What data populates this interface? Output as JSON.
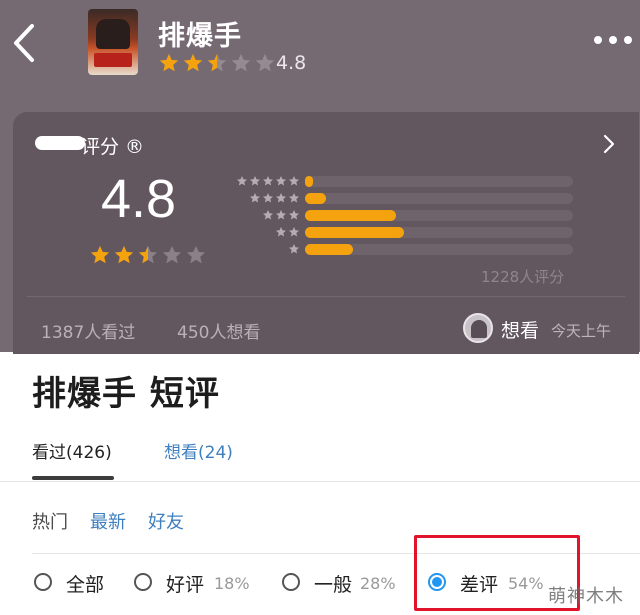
{
  "header": {
    "title": "排爆手",
    "score": "4.8",
    "stars": [
      1,
      1,
      0.5,
      0,
      0
    ],
    "star_color": "#f5a20f",
    "icons": {
      "back": "back-arrow-icon",
      "more": "more-dots-icon"
    }
  },
  "rating_card": {
    "label": "评分 ®",
    "score": "4.8",
    "stars": [
      1,
      1,
      0.5,
      0,
      0
    ],
    "distribution": [
      {
        "stars": 5,
        "fraction": 0.03
      },
      {
        "stars": 4,
        "fraction": 0.08
      },
      {
        "stars": 3,
        "fraction": 0.34
      },
      {
        "stars": 2,
        "fraction": 0.37
      },
      {
        "stars": 1,
        "fraction": 0.18
      }
    ],
    "rating_count": "1228人评分",
    "watched": "1387人看过",
    "wishes": "450人想看",
    "want_label": "想看",
    "time": "今天上午"
  },
  "reviews": {
    "title": "排爆手 短评",
    "tabs": [
      {
        "label": "看过(426)",
        "active": true
      },
      {
        "label": "想看(24)",
        "active": false
      }
    ],
    "sort": [
      "热门",
      "最新",
      "好友"
    ],
    "filters": [
      {
        "label": "全部",
        "pct": "",
        "checked": false
      },
      {
        "label": "好评",
        "pct": "18%",
        "checked": false
      },
      {
        "label": "一般",
        "pct": "28%",
        "checked": false
      },
      {
        "label": "差评",
        "pct": "54%",
        "checked": true
      }
    ]
  },
  "watermark": "萌神木木"
}
